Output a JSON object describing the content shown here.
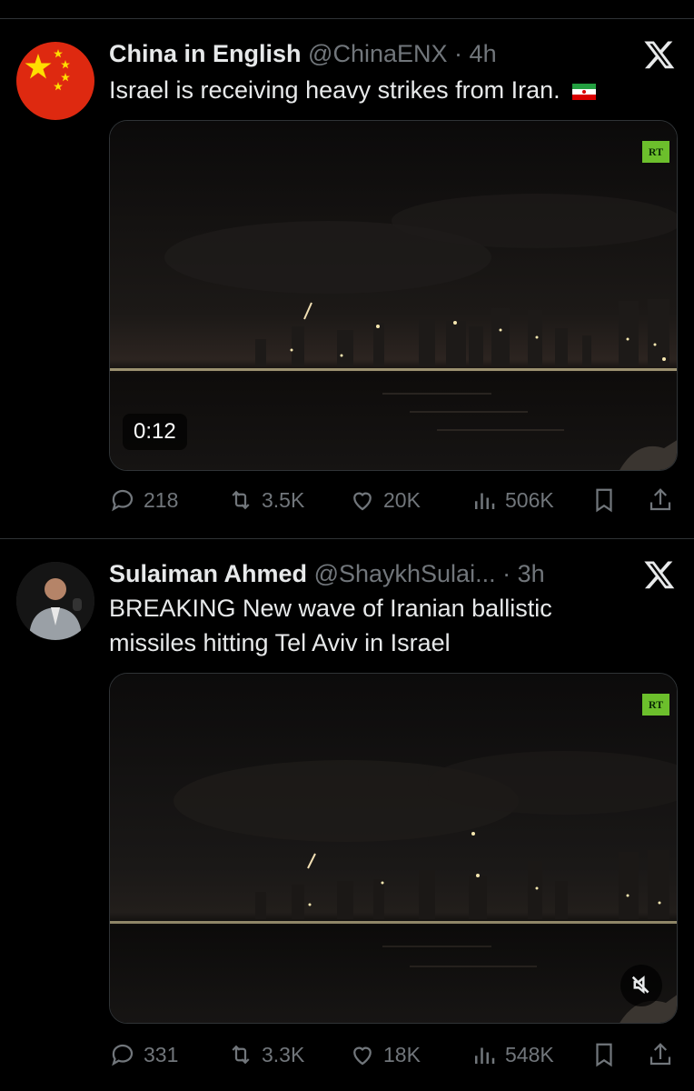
{
  "tweets": [
    {
      "name": "China in English",
      "handle": "@ChinaENX",
      "separator": "·",
      "time": "4h",
      "text": "Israel is receiving heavy strikes from Iran.",
      "flag_emoji": "iran-flag-icon",
      "media": {
        "badge": "RT",
        "duration": "0:12"
      },
      "stats": {
        "replies": "218",
        "reposts": "3.5K",
        "likes": "20K",
        "views": "506K"
      }
    },
    {
      "name": "Sulaiman Ahmed",
      "handle": "@ShaykhSulai...",
      "separator": "·",
      "time": "3h",
      "text_line1": "BREAKING New wave of Iranian ballistic",
      "text_line2": "missiles hitting Tel Aviv in Israel",
      "media": {
        "badge": "RT"
      },
      "stats": {
        "replies": "331",
        "reposts": "3.3K",
        "likes": "18K",
        "views": "548K"
      }
    }
  ],
  "colors": {
    "background": "#000000",
    "text": "#e7e9ea",
    "muted": "#71767b",
    "divider": "#2f3336"
  }
}
